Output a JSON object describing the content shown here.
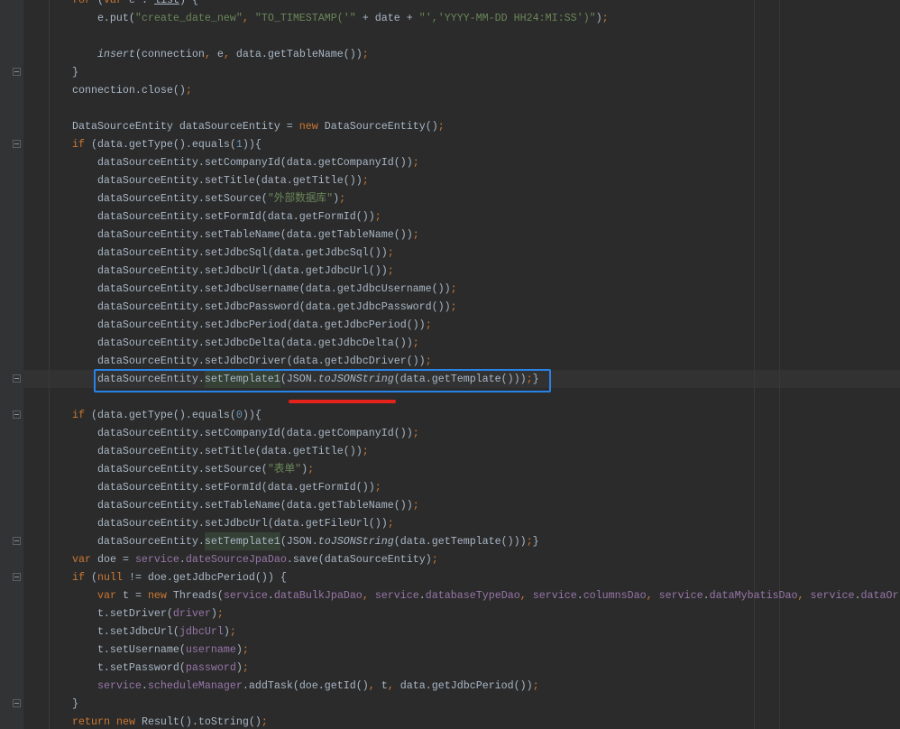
{
  "theme": {
    "background": "#2B2B2B",
    "gutter": "#313335",
    "caret_row": "#323232",
    "text": "#A9B7C6",
    "keyword": "#CC7832",
    "string": "#6A8759",
    "number": "#6897BB",
    "field": "#9876AA",
    "usage_highlight": "#344134",
    "indent_guide": "#393939",
    "margin_guide": "#383838",
    "fold_border": "#5B5F61",
    "fold_line": "#8C9093",
    "annotation_box": "#2882E8",
    "annotation_underline": "#E5231B"
  },
  "editor": {
    "caret_line": 21,
    "fold_markers": [
      {
        "line": 4,
        "icon": "fold-end-icon"
      },
      {
        "line": 8,
        "icon": "fold-collapse-icon"
      },
      {
        "line": 21,
        "icon": "fold-end-icon"
      },
      {
        "line": 23,
        "icon": "fold-collapse-icon"
      },
      {
        "line": 30,
        "icon": "fold-end-icon"
      },
      {
        "line": 32,
        "icon": "fold-collapse-icon"
      },
      {
        "line": 39,
        "icon": "fold-end-icon"
      }
    ],
    "lines": [
      [
        {
          "p": "        "
        },
        {
          "kw": "for"
        },
        {
          "p": " ("
        },
        {
          "kw": "var"
        },
        {
          "p": " e : "
        },
        {
          "und": "list"
        },
        {
          "p": ") {"
        }
      ],
      [
        {
          "p": "            e.put("
        },
        {
          "str": "\"create_date_new\""
        },
        {
          "pun": ","
        },
        {
          "p": " "
        },
        {
          "str": "\"TO_TIMESTAMP('\""
        },
        {
          "p": " + date + "
        },
        {
          "str": "\"','YYYY-MM-DD HH24:MI:SS')\""
        },
        {
          "p": ")"
        },
        {
          "pun": ";"
        }
      ],
      [],
      [
        {
          "p": "            "
        },
        {
          "it": "insert"
        },
        {
          "p": "(connection"
        },
        {
          "pun": ","
        },
        {
          "p": " e"
        },
        {
          "pun": ","
        },
        {
          "p": " data.getTableName())"
        },
        {
          "pun": ";"
        }
      ],
      [
        {
          "p": "        }"
        }
      ],
      [
        {
          "p": "        connection.close()"
        },
        {
          "pun": ";"
        }
      ],
      [],
      [
        {
          "p": "        DataSourceEntity dataSourceEntity = "
        },
        {
          "kw": "new"
        },
        {
          "p": " DataSourceEntity()"
        },
        {
          "pun": ";"
        }
      ],
      [
        {
          "p": "        "
        },
        {
          "kw": "if"
        },
        {
          "p": " (data.getType().equals("
        },
        {
          "num": "1"
        },
        {
          "p": ")){"
        }
      ],
      [
        {
          "p": "            dataSourceEntity.setCompanyId(data.getCompanyId())"
        },
        {
          "pun": ";"
        }
      ],
      [
        {
          "p": "            dataSourceEntity.setTitle(data.getTitle())"
        },
        {
          "pun": ";"
        }
      ],
      [
        {
          "p": "            dataSourceEntity.setSource("
        },
        {
          "str": "\"外部数据库\""
        },
        {
          "p": ")"
        },
        {
          "pun": ";"
        }
      ],
      [
        {
          "p": "            dataSourceEntity.setFormId(data.getFormId())"
        },
        {
          "pun": ";"
        }
      ],
      [
        {
          "p": "            dataSourceEntity.setTableName(data.getTableName())"
        },
        {
          "pun": ";"
        }
      ],
      [
        {
          "p": "            dataSourceEntity.setJdbcSql(data.getJdbcSql())"
        },
        {
          "pun": ";"
        }
      ],
      [
        {
          "p": "            dataSourceEntity.setJdbcUrl(data.getJdbcUrl())"
        },
        {
          "pun": ";"
        }
      ],
      [
        {
          "p": "            dataSourceEntity.setJdbcUsername(data.getJdbcUsername())"
        },
        {
          "pun": ";"
        }
      ],
      [
        {
          "p": "            dataSourceEntity.setJdbcPassword(data.getJdbcPassword())"
        },
        {
          "pun": ";"
        }
      ],
      [
        {
          "p": "            dataSourceEntity.setJdbcPeriod(data.getJdbcPeriod())"
        },
        {
          "pun": ";"
        }
      ],
      [
        {
          "p": "            dataSourceEntity.setJdbcDelta(data.getJdbcDelta())"
        },
        {
          "pun": ";"
        }
      ],
      [
        {
          "p": "            dataSourceEntity.setJdbcDriver(data.getJdbcDriver())"
        },
        {
          "pun": ";"
        }
      ],
      [
        {
          "p": "            dataSourceEntity."
        },
        {
          "hl": "setTemplate1"
        },
        {
          "p": "(JSON."
        },
        {
          "it": "toJSONString"
        },
        {
          "p": "(data.getTemplate()))"
        },
        {
          "pun": ";"
        },
        {
          "p": "}"
        }
      ],
      [],
      [
        {
          "p": "        "
        },
        {
          "kw": "if"
        },
        {
          "p": " (data.getType().equals("
        },
        {
          "num": "0"
        },
        {
          "p": ")){"
        }
      ],
      [
        {
          "p": "            dataSourceEntity.setCompanyId(data.getCompanyId())"
        },
        {
          "pun": ";"
        }
      ],
      [
        {
          "p": "            dataSourceEntity.setTitle(data.getTitle())"
        },
        {
          "pun": ";"
        }
      ],
      [
        {
          "p": "            dataSourceEntity.setSource("
        },
        {
          "str": "\"表单\""
        },
        {
          "p": ")"
        },
        {
          "pun": ";"
        }
      ],
      [
        {
          "p": "            dataSourceEntity.setFormId(data.getFormId())"
        },
        {
          "pun": ";"
        }
      ],
      [
        {
          "p": "            dataSourceEntity.setTableName(data.getTableName())"
        },
        {
          "pun": ";"
        }
      ],
      [
        {
          "p": "            dataSourceEntity.setJdbcUrl(data.getFileUrl())"
        },
        {
          "pun": ";"
        }
      ],
      [
        {
          "p": "            dataSourceEntity."
        },
        {
          "hl": "setTemplate1"
        },
        {
          "p": "(JSON."
        },
        {
          "it": "toJSONString"
        },
        {
          "p": "(data.getTemplate()))"
        },
        {
          "pun": ";"
        },
        {
          "p": "}"
        }
      ],
      [
        {
          "p": "        "
        },
        {
          "kw": "var"
        },
        {
          "p": " doe = "
        },
        {
          "fld": "service"
        },
        {
          "p": "."
        },
        {
          "fld": "dateSourceJpaDao"
        },
        {
          "p": ".save(dataSourceEntity)"
        },
        {
          "pun": ";"
        }
      ],
      [
        {
          "p": "        "
        },
        {
          "kw": "if"
        },
        {
          "p": " ("
        },
        {
          "kw": "null"
        },
        {
          "p": " != doe.getJdbcPeriod()) {"
        }
      ],
      [
        {
          "p": "            "
        },
        {
          "kw": "var"
        },
        {
          "p": " t = "
        },
        {
          "kw": "new"
        },
        {
          "p": " Threads("
        },
        {
          "fld": "service"
        },
        {
          "p": "."
        },
        {
          "fld": "dataBulkJpaDao"
        },
        {
          "pun": ","
        },
        {
          "p": " "
        },
        {
          "fld": "service"
        },
        {
          "p": "."
        },
        {
          "fld": "databaseTypeDao"
        },
        {
          "pun": ","
        },
        {
          "p": " "
        },
        {
          "fld": "service"
        },
        {
          "p": "."
        },
        {
          "fld": "columnsDao"
        },
        {
          "pun": ","
        },
        {
          "p": " "
        },
        {
          "fld": "service"
        },
        {
          "p": "."
        },
        {
          "fld": "dataMybatisDao"
        },
        {
          "pun": ","
        },
        {
          "p": " "
        },
        {
          "fld": "service"
        },
        {
          "p": "."
        },
        {
          "fld": "dataOr"
        }
      ],
      [
        {
          "p": "            t.setDriver("
        },
        {
          "fld": "driver"
        },
        {
          "p": ")"
        },
        {
          "pun": ";"
        }
      ],
      [
        {
          "p": "            t.setJdbcUrl("
        },
        {
          "fld": "jdbcUrl"
        },
        {
          "p": ")"
        },
        {
          "pun": ";"
        }
      ],
      [
        {
          "p": "            t.setUsername("
        },
        {
          "fld": "username"
        },
        {
          "p": ")"
        },
        {
          "pun": ";"
        }
      ],
      [
        {
          "p": "            t.setPassword("
        },
        {
          "fld": "password"
        },
        {
          "p": ")"
        },
        {
          "pun": ";"
        }
      ],
      [
        {
          "p": "            "
        },
        {
          "fld": "service"
        },
        {
          "p": "."
        },
        {
          "fld": "scheduleManager"
        },
        {
          "p": ".addTask(doe.getId()"
        },
        {
          "pun": ","
        },
        {
          "p": " t"
        },
        {
          "pun": ","
        },
        {
          "p": " data.getJdbcPeriod())"
        },
        {
          "pun": ";"
        }
      ],
      [
        {
          "p": "        }"
        }
      ],
      [
        {
          "p": "        "
        },
        {
          "kw": "return"
        },
        {
          "p": " "
        },
        {
          "kw": "new"
        },
        {
          "p": " Result().toString()"
        },
        {
          "pun": ";"
        }
      ]
    ]
  }
}
